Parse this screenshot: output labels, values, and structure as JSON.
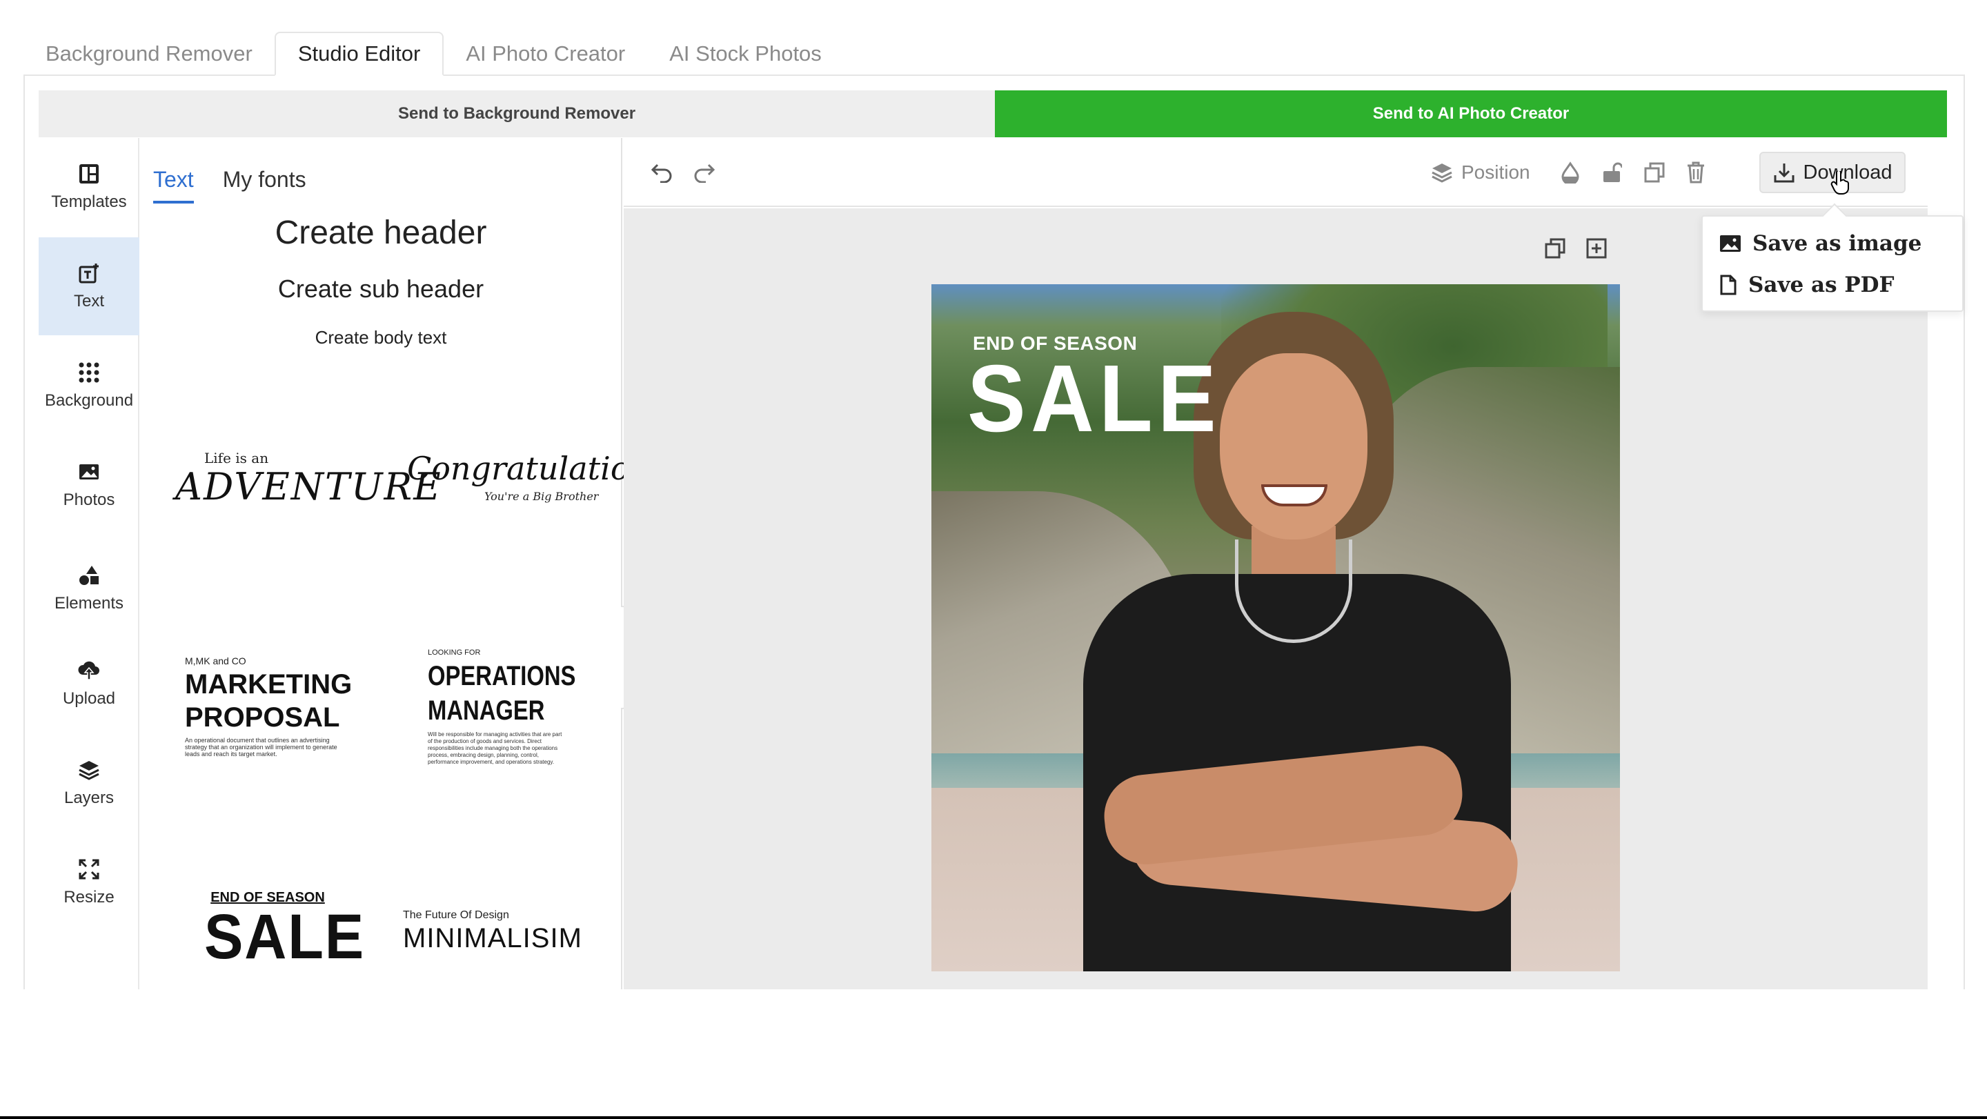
{
  "top_tabs": [
    {
      "label": "Background Remover"
    },
    {
      "label": "Studio Editor",
      "active": true
    },
    {
      "label": "AI Photo Creator"
    },
    {
      "label": "AI Stock Photos"
    }
  ],
  "send_bar": {
    "left_label": "Send to Background Remover",
    "right_label": "Send to AI Photo Creator",
    "right_color": "#2db12d"
  },
  "rail": [
    {
      "label": "Templates",
      "icon": "templates-icon"
    },
    {
      "label": "Text",
      "icon": "text-icon",
      "active": true
    },
    {
      "label": "Background",
      "icon": "grid-dots-icon"
    },
    {
      "label": "Photos",
      "icon": "image-icon"
    },
    {
      "label": "Elements",
      "icon": "shapes-icon"
    },
    {
      "label": "Upload",
      "icon": "upload-cloud-icon"
    },
    {
      "label": "Layers",
      "icon": "layers-icon"
    },
    {
      "label": "Resize",
      "icon": "resize-arrows-icon"
    }
  ],
  "panel": {
    "tabs": [
      {
        "label": "Text",
        "active": true
      },
      {
        "label": "My fonts"
      }
    ],
    "create_header": "Create header",
    "create_sub_header": "Create sub header",
    "create_body": "Create body text",
    "templates": {
      "adventure": {
        "small": "Life is an",
        "big": "ADVENTURE"
      },
      "congrats": {
        "big": "Congratulations!",
        "small": "You're a Big Brother"
      },
      "marketing": {
        "tiny": "M,MK and CO",
        "big1": "MARKETING",
        "big2": "PROPOSAL",
        "body": "An operational document that outlines an advertising strategy that an organization will implement to generate leads and reach its target market."
      },
      "operations": {
        "tiny": "LOOKING FOR",
        "big1": "OPERATIONS",
        "big2": "MANAGER",
        "body": "Will be responsible for managing activities that are part of the production of goods and services. Direct responsibilities include managing both the operations process, embracing design, planning, control, performance improvement, and operations strategy."
      },
      "sale": {
        "tiny": "END OF SEASON",
        "big": "SALE"
      },
      "minimalism": {
        "tiny": "The Future Of Design",
        "big": "MINIMALISIM"
      }
    }
  },
  "toolbar": {
    "position_label": "Position",
    "download_label": "Download"
  },
  "canvas": {
    "text_top": "END OF SEASON",
    "text_big": "SALE"
  },
  "download_menu": [
    {
      "label": "Save as image",
      "icon": "image-icon"
    },
    {
      "label": "Save as PDF",
      "icon": "document-icon"
    }
  ]
}
